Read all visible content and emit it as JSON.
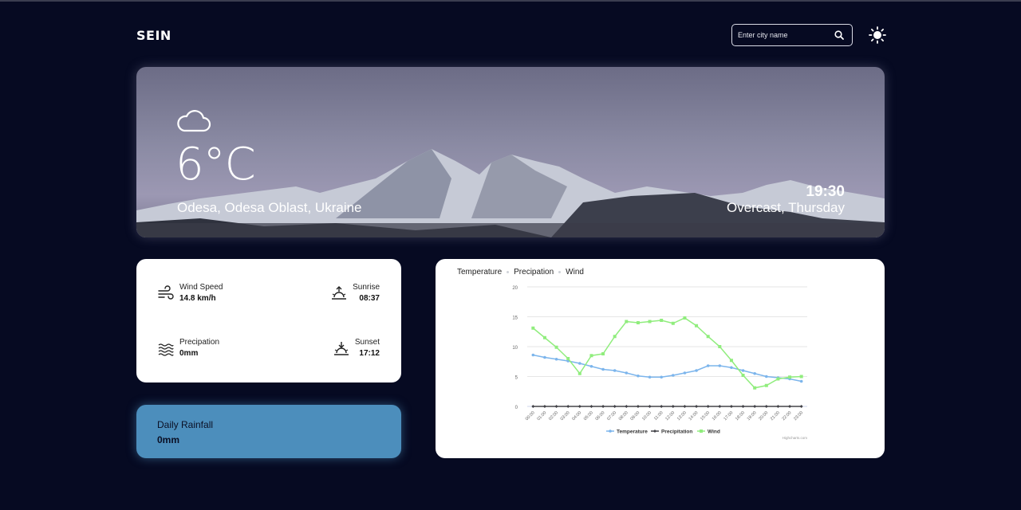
{
  "header": {
    "logo": "SEIN",
    "search_placeholder": "Enter city name"
  },
  "hero": {
    "icon": "cloud-icon",
    "temperature": "6°C",
    "location": "Odesa, Odesa Oblast, Ukraine",
    "time": "19:30",
    "condition": "Overcast, Thursday"
  },
  "stats": {
    "wind": {
      "label": "Wind Speed",
      "value": "14.8 km/h",
      "icon": "wind-icon"
    },
    "sunrise": {
      "label": "Sunrise",
      "value": "08:37",
      "icon": "sunrise-icon"
    },
    "precipitation": {
      "label": "Precipation",
      "value": "0mm",
      "icon": "waves-icon"
    },
    "sunset": {
      "label": "Sunset",
      "value": "17:12",
      "icon": "sunset-icon"
    }
  },
  "rainfall": {
    "title": "Daily Rainfall",
    "value": "0mm"
  },
  "chart_tabs": [
    "Temperature",
    "Precipation",
    "Wind"
  ],
  "chart_data": {
    "type": "line",
    "x": [
      "00:00",
      "01:00",
      "02:00",
      "03:00",
      "04:00",
      "05:00",
      "06:00",
      "07:00",
      "08:00",
      "09:00",
      "10:00",
      "11:00",
      "12:00",
      "13:00",
      "14:00",
      "15:00",
      "16:00",
      "17:00",
      "18:00",
      "19:00",
      "20:00",
      "21:00",
      "22:00",
      "23:00"
    ],
    "ylim": [
      0,
      20
    ],
    "yticks": [
      0,
      5,
      10,
      15,
      20
    ],
    "grid": true,
    "legend": "bottom",
    "credit": "Highcharts.com",
    "series": [
      {
        "name": "Temperature",
        "color": "#7cb5ec",
        "values": [
          8.6,
          8.2,
          7.9,
          7.6,
          7.2,
          6.7,
          6.2,
          6.0,
          5.6,
          5.1,
          4.9,
          4.9,
          5.2,
          5.6,
          6.0,
          6.8,
          6.8,
          6.5,
          6.0,
          5.5,
          5.0,
          4.8,
          4.6,
          4.2
        ]
      },
      {
        "name": "Precipitation",
        "color": "#434348",
        "values": [
          0,
          0,
          0,
          0,
          0,
          0,
          0,
          0,
          0,
          0,
          0,
          0,
          0,
          0,
          0,
          0,
          0,
          0,
          0,
          0,
          0,
          0,
          0,
          0
        ]
      },
      {
        "name": "Wind",
        "color": "#90ed7d",
        "values": [
          13.1,
          11.5,
          9.9,
          8.0,
          5.5,
          8.5,
          8.8,
          11.7,
          14.2,
          14.0,
          14.2,
          14.4,
          13.9,
          14.8,
          13.5,
          11.7,
          10.0,
          7.7,
          5.2,
          3.1,
          3.5,
          4.6,
          4.9,
          5.0
        ]
      }
    ]
  }
}
